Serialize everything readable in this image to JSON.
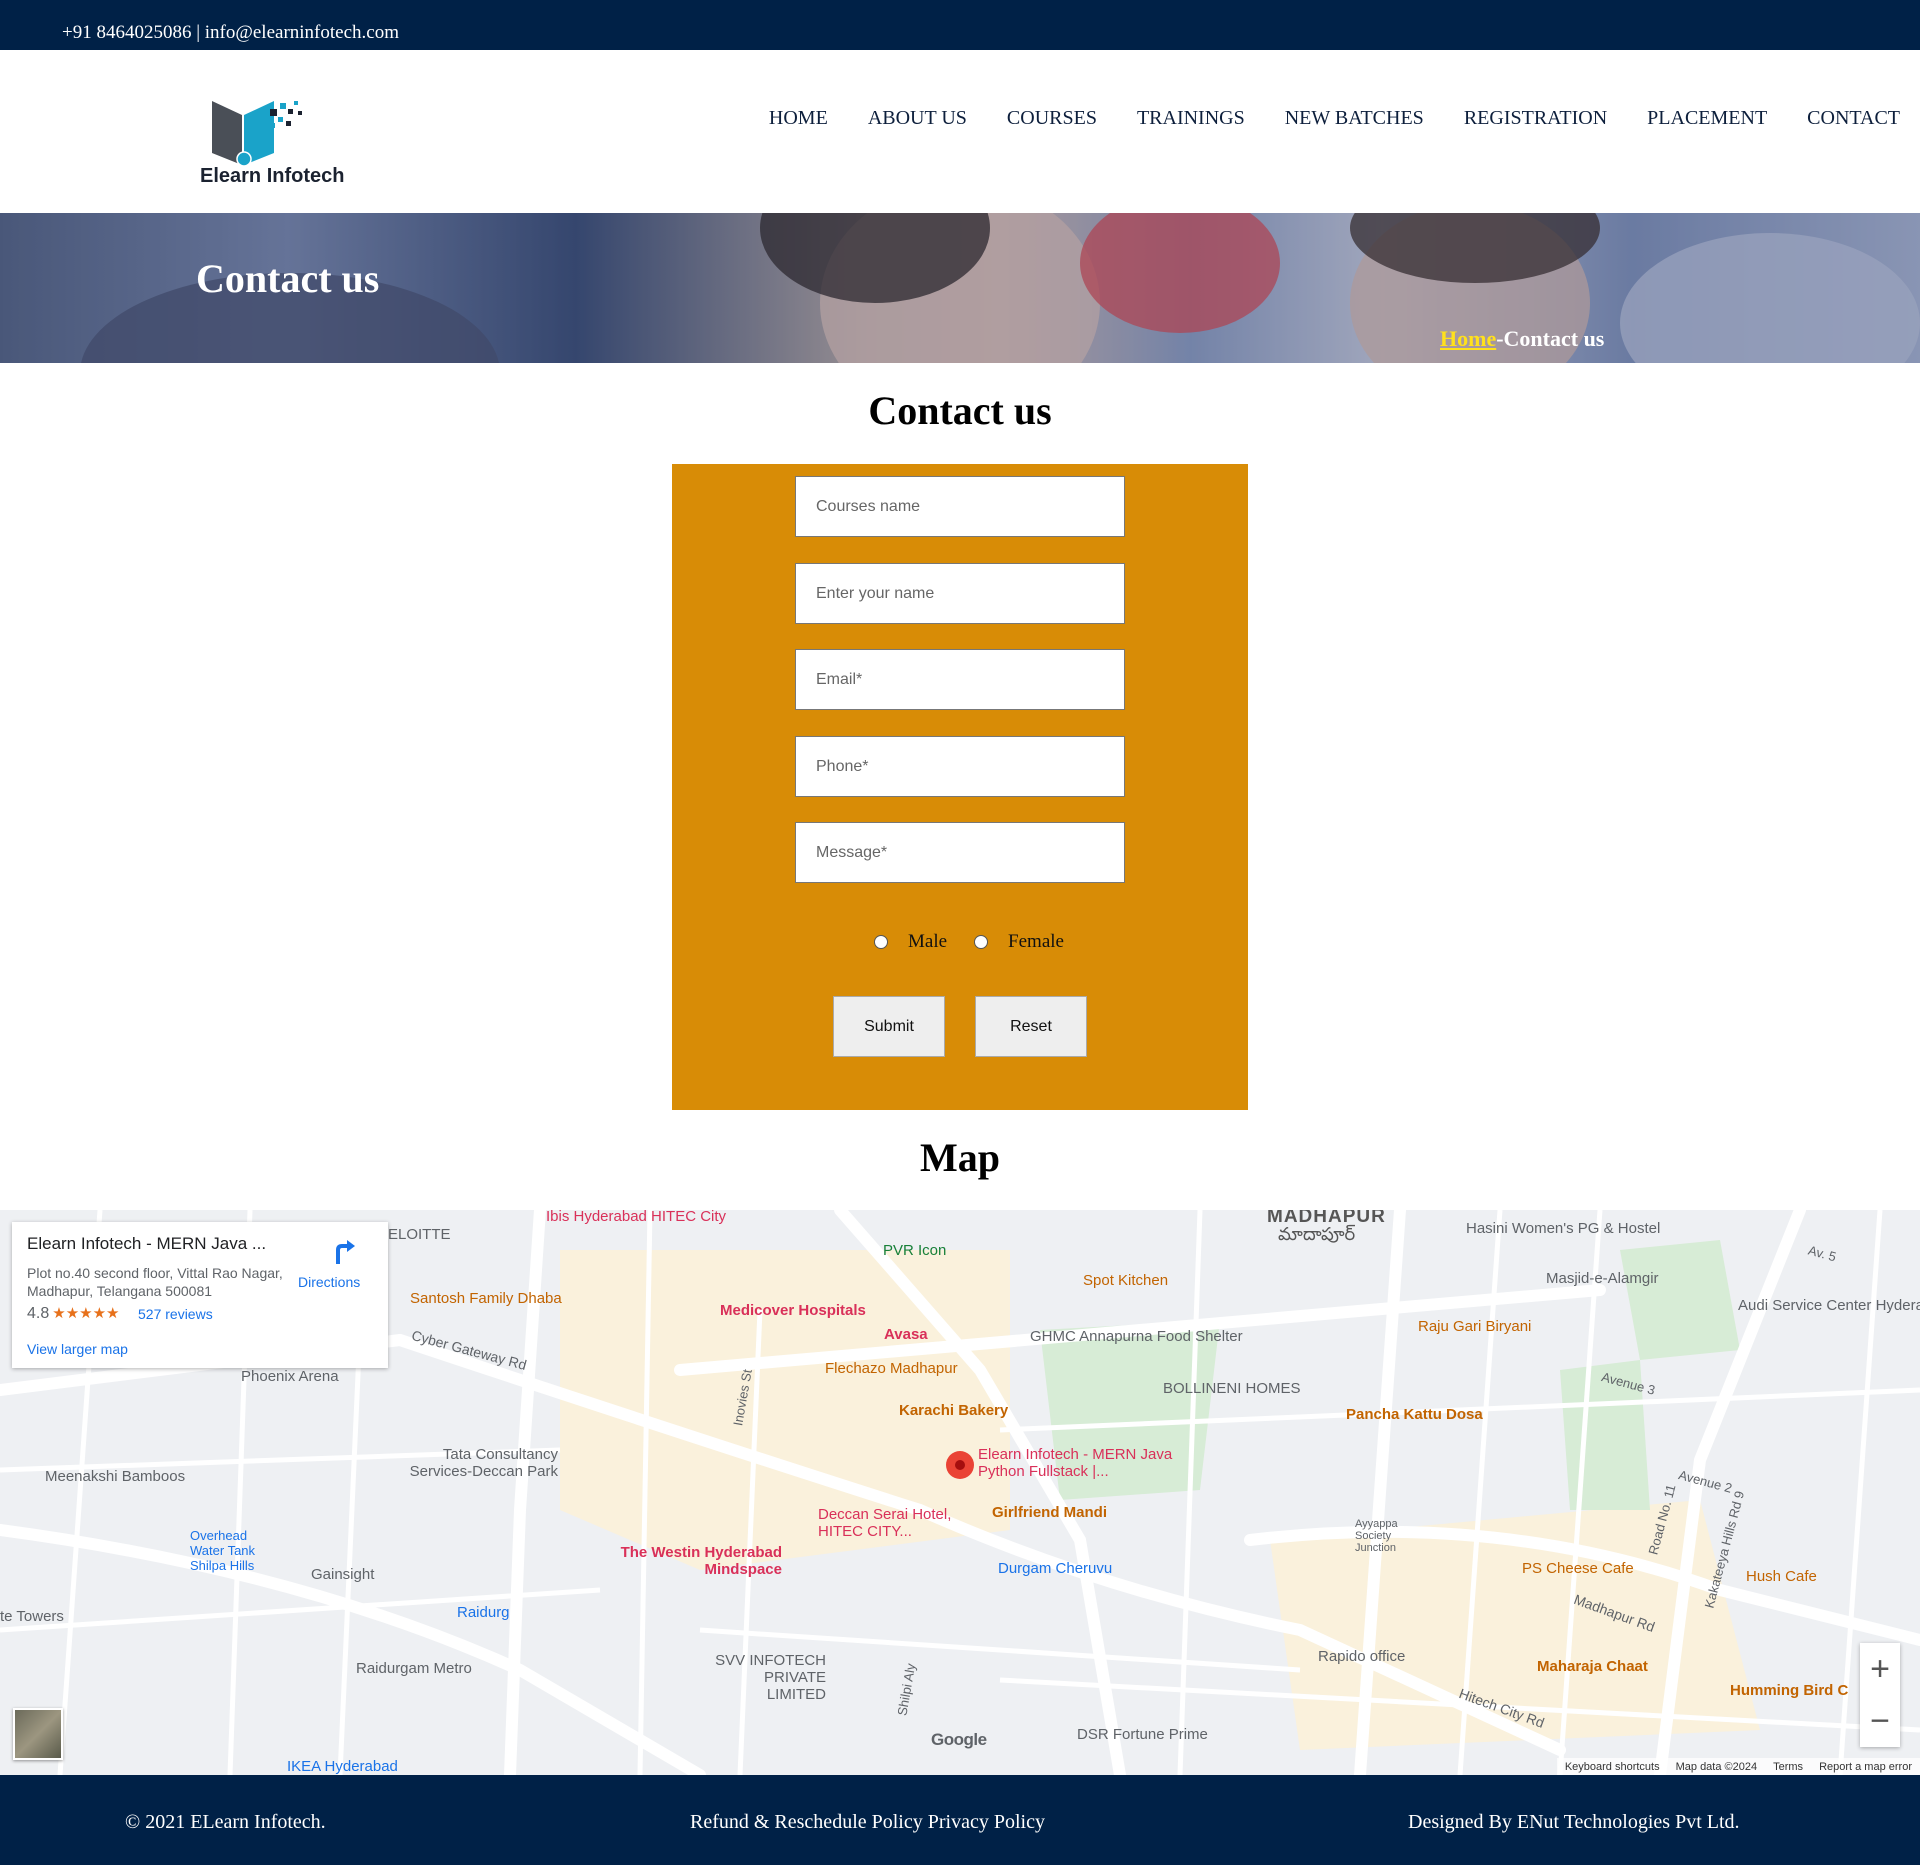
{
  "topbar": {
    "contact": "+91 8464025086 | info@elearninfotech.com"
  },
  "logo": {
    "text": "Elearn Infotech"
  },
  "nav": [
    "HOME",
    "ABOUT US",
    "COURSES",
    "TRAININGS",
    "NEW BATCHES",
    "REGISTRATION",
    "PLACEMENT",
    "CONTACT"
  ],
  "banner": {
    "title": "Contact us",
    "crumb_home": "Home",
    "crumb_sep": "-",
    "crumb_current": "Contact us"
  },
  "contact_section": {
    "title": "Contact us"
  },
  "form": {
    "courses_placeholder": "Courses name",
    "name_placeholder": "Enter your name",
    "email_placeholder": "Email*",
    "phone_placeholder": "Phone*",
    "message_placeholder": "Message*",
    "male": "Male",
    "female": "Female",
    "submit": "Submit",
    "reset": "Reset"
  },
  "map_section": {
    "title": "Map"
  },
  "map": {
    "card": {
      "name": "Elearn Infotech - MERN Java ...",
      "address": "Plot no.40 second floor, Vittal Rao Nagar, Madhapur, Telangana 500081",
      "rating": "4.8",
      "stars": "★★★★★",
      "reviews": "527 reviews",
      "larger_map": "View larger map",
      "directions": "Directions"
    },
    "places": [
      "MADHAPUR",
      "మాదాపూర్",
      "Hasini Women's PG & Hostel",
      "Masjid-e-Alamgir",
      "Audi Service Center Hyderabad",
      "Ibis Hyderabad HITEC City",
      "PVR Icon",
      "Santosh Family Dhaba",
      "Medicover Hospitals",
      "Avasa",
      "Spot Kitchen",
      "GHMC Annapurna Food Shelter",
      "Raju Gari Biryani",
      "Flechazo Madhapur",
      "BOLLINENI HOMES",
      "Karachi Bakery",
      "Pancha Kattu Dosa",
      "Phoenix Arena",
      "Tata Consultancy Services-Deccan Park",
      "Elearn Infotech - MERN Java Python Fullstack |...",
      "Meenakshi Bamboos",
      "Girlfriend Mandi",
      "Deccan Serai Hotel, HITEC CITY...",
      "The Westin Hyderabad Mindspace",
      "Durgam Cheruvu",
      "Ayyappa Society Junction",
      "PS Cheese Cafe",
      "Hush Cafe",
      "Overhead Water Tank Shilpa Hills",
      "Gainsight",
      "Raidurg",
      "te Towers",
      "Raidurgam Metro",
      "SVV INFOTECH PRIVATE LIMITED",
      "Rapido office",
      "Maharaja Chaat",
      "Humming Bird C",
      "DSR Fortune Prime",
      "IKEA Hyderabad",
      "ELOITTE",
      "Cyber Gateway Rd",
      "Madhapur Rd",
      "Hitech City Rd",
      "Shilpi Aly",
      "Inovies St",
      "Avenue 3",
      "Avenue 2",
      "Road No. 11",
      "Kakateeya Hills Rd 9",
      "Av. 5"
    ],
    "attribution": [
      "Keyboard shortcuts",
      "Map data ©2024",
      "Terms",
      "Report a map error"
    ],
    "google": "Google"
  },
  "footer": {
    "copyright": "© 2021 ELearn Infotech.",
    "policies": "Refund & Reschedule Policy Privacy Policy",
    "designed": "Designed By ENut Technologies Pvt Ltd."
  }
}
